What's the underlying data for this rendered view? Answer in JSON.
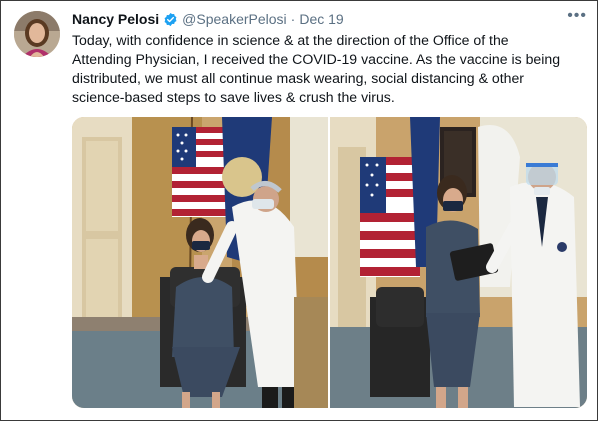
{
  "tweet": {
    "author_name": "Nancy Pelosi",
    "handle": "@SpeakerPelosi",
    "separator": "·",
    "date": "Dec 19",
    "more_glyph": "•••",
    "text": "Today, with confidence in science & at the direction of the Office of the\nAttending Physician, I received the COVID-19 vaccine. As the vaccine is being\ndistributed, we must all continue mask wearing, social distancing & other\nscience-based steps to save lives & crush the virus."
  },
  "icons": {
    "verified": "verified-badge-icon",
    "more": "more-options-icon"
  },
  "colors": {
    "verified_blue": "#1da1f2",
    "secondary_text": "#5b7083",
    "primary_text": "#0f1419"
  },
  "media": {
    "photo_count": 2
  }
}
